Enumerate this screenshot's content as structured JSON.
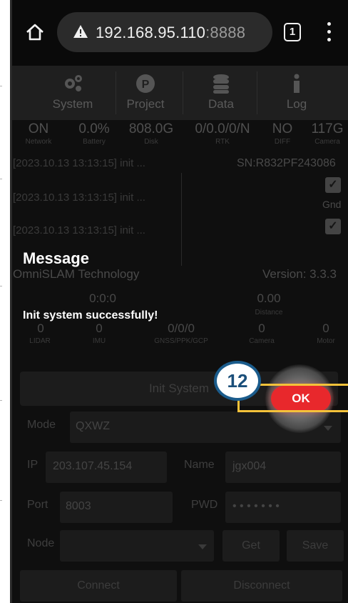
{
  "browser": {
    "url_host": "192.168.95.110",
    "url_port": ":8888",
    "tab_count": "1"
  },
  "nav": {
    "tabs": [
      {
        "label": "System",
        "icon": "gears-icon"
      },
      {
        "label": "Project",
        "icon": "project-p-icon"
      },
      {
        "label": "Data",
        "icon": "database-icon"
      },
      {
        "label": "Log",
        "icon": "info-icon"
      }
    ]
  },
  "stats": [
    {
      "value": "ON",
      "key": "Network"
    },
    {
      "value": "0.0%",
      "key": "Battery"
    },
    {
      "value": "808.0G",
      "key": "Disk"
    },
    {
      "value": "0/0.0/0/N",
      "key": "RTK"
    },
    {
      "value": "NO",
      "key": "DIFF"
    },
    {
      "value": "117G",
      "key": "Camera"
    }
  ],
  "log": {
    "lines": [
      "[2023.10.13 13:13:15] init ...",
      "[2023.10.13 13:13:15] init ...",
      "[2023.10.13 13:13:15] init ..."
    ],
    "sn": "SN:R832PF243086",
    "gnd_label": "Gnd"
  },
  "system_info": {
    "company": "OmniSLAM Technology",
    "version": "Version: 3.3.3"
  },
  "sensors": {
    "time": "0:0:0",
    "distance_value": "0.00",
    "distance_label": "Distance",
    "items": [
      {
        "value": "0",
        "key": "LIDAR"
      },
      {
        "value": "0",
        "key": "IMU"
      },
      {
        "value": "0/0/0",
        "key": "GNSS/PPK/GCP"
      },
      {
        "value": "0",
        "key": "Camera"
      },
      {
        "value": "0",
        "key": "Motor"
      }
    ]
  },
  "controls": {
    "init_system_label": "Init System",
    "mode_label": "Mode",
    "mode_value": "QXWZ",
    "ip_label": "IP",
    "ip_value": "203.107.45.154",
    "name_label": "Name",
    "name_value": "jgx004",
    "port_label": "Port",
    "port_value": "8003",
    "pwd_label": "PWD",
    "pwd_value": "• • • • • • •",
    "node_label": "Node",
    "get_label": "Get",
    "save_label": "Save",
    "connect_label": "Connect",
    "disconnect_label": "Disconnect"
  },
  "dialog": {
    "title": "Message",
    "message": "Init system successfully!",
    "ok_label": "OK"
  },
  "annotation": {
    "step_number": "12",
    "accent_color": "#f4c23a",
    "badge_color": "#1b5c8c"
  },
  "colors": {
    "ok_button": "#e8282c",
    "backdrop": "#111111"
  }
}
